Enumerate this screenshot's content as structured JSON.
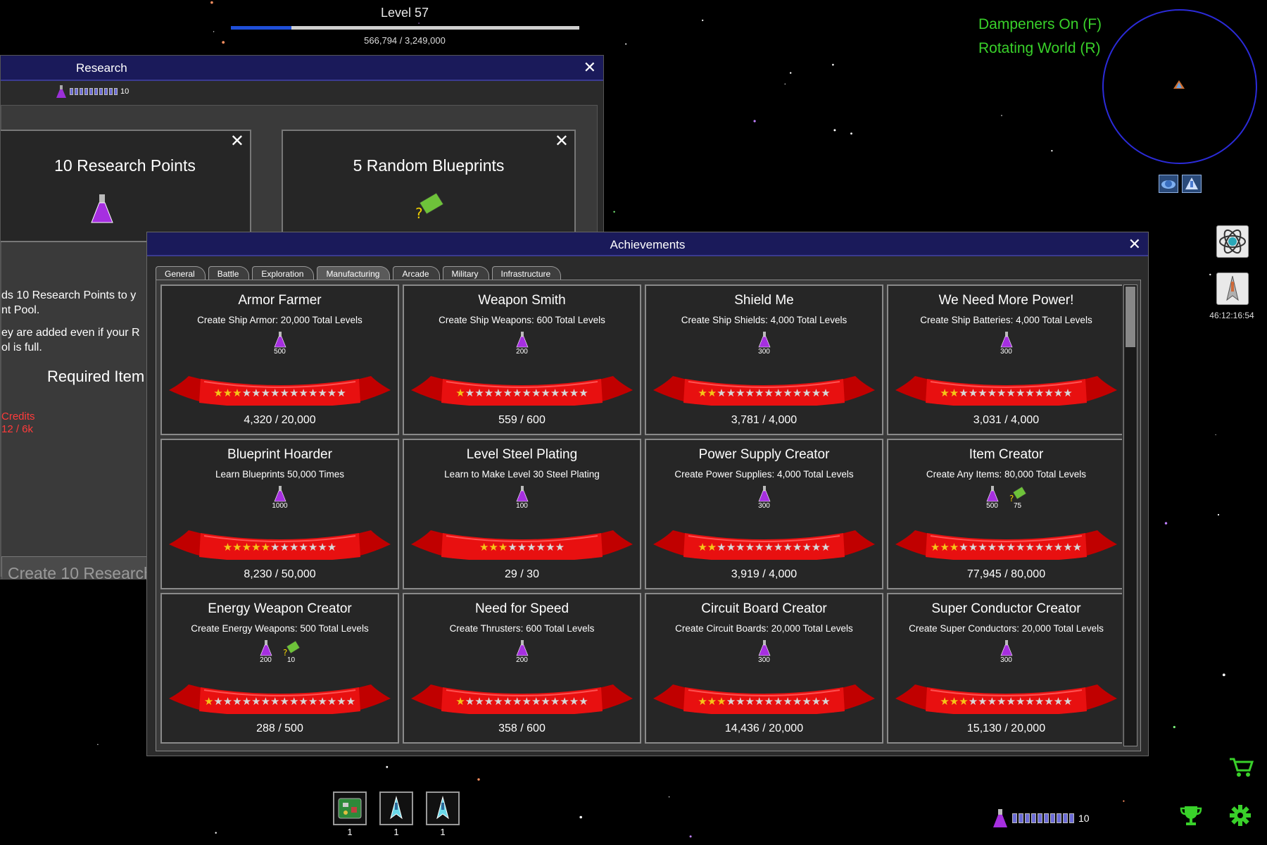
{
  "level": {
    "title": "Level 57",
    "xp_text": "566,794 / 3,249,000",
    "progress": 0.1745
  },
  "hud": {
    "dampeners": "Dampeners On (F)",
    "rotating": "Rotating World (R)",
    "clock": "46:12:16:54"
  },
  "research_window": {
    "title": "Research",
    "points": "10",
    "card1_title": "10 Research Points",
    "card2_title": "5 Random Blueprints",
    "desc_line1": "ds 10 Research Points to y",
    "desc_line2": "nt Pool.",
    "desc_line3": "ey are added even if your R",
    "desc_line4": "ol is full.",
    "required_items": "Required Item",
    "credits_label": "Credits",
    "credits_value": "12 / 6k",
    "create_button": "Create 10 Research"
  },
  "achievements_window": {
    "title": "Achievements",
    "tabs": [
      "General",
      "Battle",
      "Exploration",
      "Manufacturing",
      "Arcade",
      "Military",
      "Infrastructure"
    ],
    "active_tab": "Manufacturing",
    "items": [
      {
        "name": "Armor Farmer",
        "desc": "Create Ship Armor: 20,000 Total Levels",
        "rewards": [
          {
            "type": "research",
            "amount": "500"
          }
        ],
        "progress": "4,320 / 20,000",
        "stars_filled": 3,
        "stars_total": 14
      },
      {
        "name": "Weapon Smith",
        "desc": "Create Ship Weapons: 600 Total Levels",
        "rewards": [
          {
            "type": "research",
            "amount": "200"
          }
        ],
        "progress": "559 / 600",
        "stars_filled": 1,
        "stars_total": 14
      },
      {
        "name": "Shield Me",
        "desc": "Create Ship Shields: 4,000 Total Levels",
        "rewards": [
          {
            "type": "research",
            "amount": "300"
          }
        ],
        "progress": "3,781 / 4,000",
        "stars_filled": 2,
        "stars_total": 14
      },
      {
        "name": "We Need More Power!",
        "desc": "Create Ship Batteries: 4,000 Total Levels",
        "rewards": [
          {
            "type": "research",
            "amount": "300"
          }
        ],
        "progress": "3,031 / 4,000",
        "stars_filled": 2,
        "stars_total": 14
      },
      {
        "name": "Blueprint Hoarder",
        "desc": "Learn Blueprints 50,000 Times",
        "rewards": [
          {
            "type": "research",
            "amount": "1000"
          }
        ],
        "progress": "8,230 / 50,000",
        "stars_filled": 5,
        "stars_total": 12
      },
      {
        "name": "Level Steel Plating",
        "desc": "Learn to Make Level 30 Steel Plating",
        "rewards": [
          {
            "type": "research",
            "amount": "100"
          }
        ],
        "progress": "29 / 30",
        "stars_filled": 3,
        "stars_total": 9
      },
      {
        "name": "Power Supply Creator",
        "desc": "Create Power Supplies: 4,000 Total Levels",
        "rewards": [
          {
            "type": "research",
            "amount": "300"
          }
        ],
        "progress": "3,919 / 4,000",
        "stars_filled": 2,
        "stars_total": 14
      },
      {
        "name": "Item Creator",
        "desc": "Create Any Items: 80,000 Total Levels",
        "rewards": [
          {
            "type": "research",
            "amount": "500"
          },
          {
            "type": "blueprint",
            "amount": "75"
          }
        ],
        "progress": "77,945 / 80,000",
        "stars_filled": 3,
        "stars_total": 16
      },
      {
        "name": "Energy Weapon Creator",
        "desc": "Create Energy Weapons: 500 Total Levels",
        "rewards": [
          {
            "type": "research",
            "amount": "200"
          },
          {
            "type": "blueprint",
            "amount": "10"
          }
        ],
        "progress": "288 / 500",
        "stars_filled": 1,
        "stars_total": 16
      },
      {
        "name": "Need for Speed",
        "desc": "Create Thrusters: 600 Total Levels",
        "rewards": [
          {
            "type": "research",
            "amount": "200"
          }
        ],
        "progress": "358 / 600",
        "stars_filled": 1,
        "stars_total": 14
      },
      {
        "name": "Circuit Board Creator",
        "desc": "Create Circuit Boards: 20,000 Total Levels",
        "rewards": [
          {
            "type": "research",
            "amount": "300"
          }
        ],
        "progress": "14,436 / 20,000",
        "stars_filled": 3,
        "stars_total": 14
      },
      {
        "name": "Super Conductor Creator",
        "desc": "Create Super Conductors: 20,000 Total Levels",
        "rewards": [
          {
            "type": "research",
            "amount": "300"
          }
        ],
        "progress": "15,130 / 20,000",
        "stars_filled": 3,
        "stars_total": 14
      }
    ]
  },
  "hotbar": [
    {
      "icon": "circuit-board-icon",
      "count": "1"
    },
    {
      "icon": "ship-icon",
      "count": "1"
    },
    {
      "icon": "ship-icon",
      "count": "1"
    }
  ],
  "bottom_research_points": "10",
  "colors": {
    "accent_green": "#39d12a",
    "titlebar": "#1a1a5a",
    "radar": "#2b2bd8",
    "ribbon": "#e00000",
    "star_gold": "#f5c518",
    "star_empty": "#d8d8d8",
    "research_red": "#ff3b3b"
  }
}
